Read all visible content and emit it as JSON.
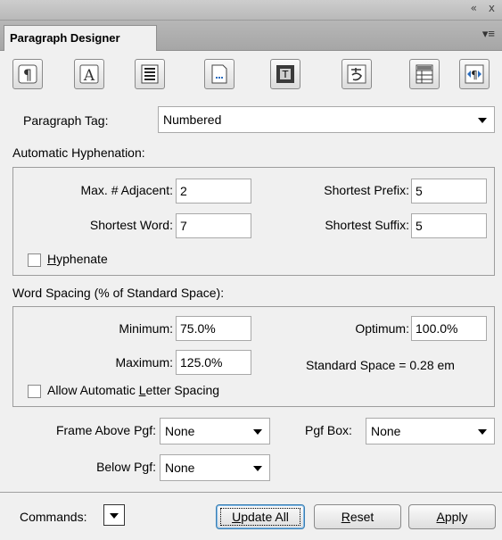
{
  "window": {
    "controls": {
      "collapse": "«",
      "close": "x"
    }
  },
  "tab": {
    "title": "Paragraph Designer",
    "menu_glyph": "▾≡"
  },
  "toolbar": {
    "icons": [
      "basic-properties-icon",
      "default-font-icon",
      "pagination-icon",
      "numbering-icon",
      "advanced-icon",
      "asian-icon",
      "table-cell-icon",
      "direction-icon"
    ]
  },
  "paragraph_tag": {
    "label": "Paragraph Tag:",
    "value": "Numbered"
  },
  "hyphenation": {
    "title": "Automatic Hyphenation:",
    "max_adjacent": {
      "label": "Max. # Adjacent:",
      "value": "2"
    },
    "shortest_word": {
      "label": "Shortest Word:",
      "value": "7"
    },
    "shortest_prefix": {
      "label": "Shortest Prefix:",
      "value": "5"
    },
    "shortest_suffix": {
      "label": "Shortest Suffix:",
      "value": "5"
    },
    "hyphenate": {
      "label_pre": "",
      "label_u": "H",
      "label_post": "yphenate",
      "checked": false
    }
  },
  "word_spacing": {
    "title": "Word Spacing (% of Standard Space):",
    "minimum": {
      "label": "Minimum:",
      "value": "75.0%"
    },
    "maximum": {
      "label": "Maximum:",
      "value": "125.0%"
    },
    "optimum": {
      "label": "Optimum:",
      "value": "100.0%"
    },
    "standard_space": "Standard Space = 0.28 em",
    "letter_spacing": {
      "label_pre": "Allow Automatic ",
      "label_u": "L",
      "label_post": "etter Spacing",
      "checked": false
    }
  },
  "frames": {
    "above": {
      "label": "Frame Above Pgf:",
      "value": "None"
    },
    "below": {
      "label": "Below Pgf:",
      "value": "None"
    },
    "pgf_box": {
      "label": "Pgf Box:",
      "value": "None"
    }
  },
  "footer": {
    "commands_label": "Commands:",
    "update_all": {
      "u": "U",
      "rest": "pdate All"
    },
    "reset": {
      "u": "R",
      "rest": "eset"
    },
    "apply": {
      "u": "A",
      "rest": "pply"
    }
  },
  "colors": {
    "panel_bg": "#f0f0f0",
    "focus_border": "#3c7fb1"
  }
}
